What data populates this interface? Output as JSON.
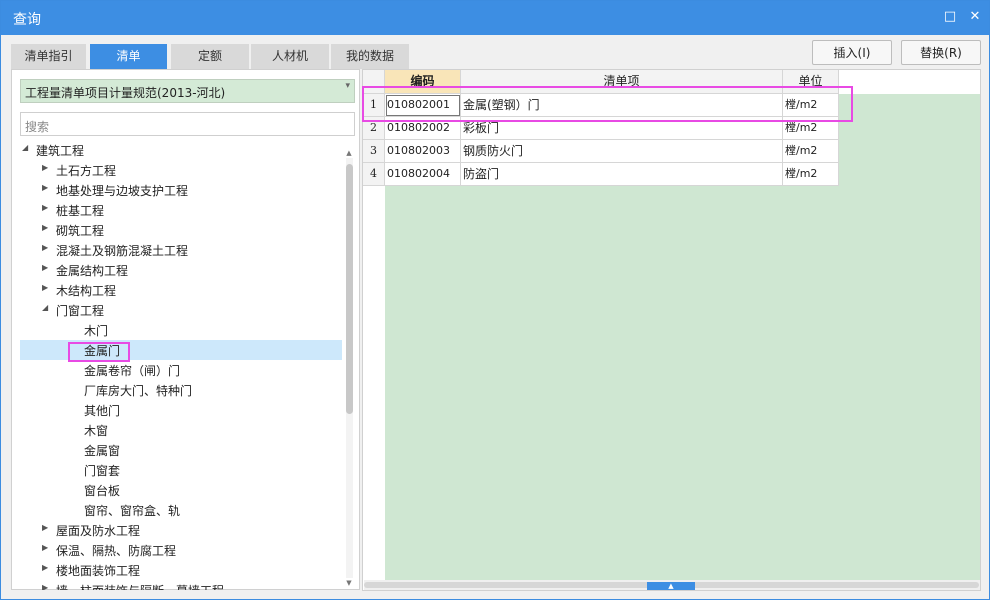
{
  "window": {
    "title": "查询",
    "restore_glyph": "□",
    "close_glyph": "✕"
  },
  "tabs": [
    {
      "label": "清单指引",
      "active": false
    },
    {
      "label": "清单",
      "active": true
    },
    {
      "label": "定额",
      "active": false
    },
    {
      "label": "人材机",
      "active": false
    },
    {
      "label": "我的数据",
      "active": false
    }
  ],
  "actions": {
    "insert_label": "插入(I)",
    "replace_label": "替换(R)"
  },
  "left_panel": {
    "spec_select": {
      "value": "工程量清单项目计量规范(2013-河北)",
      "arrow": "▾"
    },
    "search": {
      "placeholder": "搜索",
      "value": ""
    },
    "tree": [
      {
        "label": "建筑工程",
        "level": 0,
        "state": "expanded"
      },
      {
        "label": "土石方工程",
        "level": 1,
        "state": "collapsed"
      },
      {
        "label": "地基处理与边坡支护工程",
        "level": 1,
        "state": "collapsed"
      },
      {
        "label": "桩基工程",
        "level": 1,
        "state": "collapsed"
      },
      {
        "label": "砌筑工程",
        "level": 1,
        "state": "collapsed"
      },
      {
        "label": "混凝土及钢筋混凝土工程",
        "level": 1,
        "state": "collapsed"
      },
      {
        "label": "金属结构工程",
        "level": 1,
        "state": "collapsed"
      },
      {
        "label": "木结构工程",
        "level": 1,
        "state": "collapsed"
      },
      {
        "label": "门窗工程",
        "level": 1,
        "state": "expanded"
      },
      {
        "label": "木门",
        "level": 2,
        "state": "leaf"
      },
      {
        "label": "金属门",
        "level": 2,
        "state": "leaf",
        "selected": true
      },
      {
        "label": "金属卷帘（闸）门",
        "level": 2,
        "state": "leaf"
      },
      {
        "label": "厂库房大门、特种门",
        "level": 2,
        "state": "leaf"
      },
      {
        "label": "其他门",
        "level": 2,
        "state": "leaf"
      },
      {
        "label": "木窗",
        "level": 2,
        "state": "leaf"
      },
      {
        "label": "金属窗",
        "level": 2,
        "state": "leaf"
      },
      {
        "label": "门窗套",
        "level": 2,
        "state": "leaf"
      },
      {
        "label": "窗台板",
        "level": 2,
        "state": "leaf"
      },
      {
        "label": "窗帘、窗帘盒、轨",
        "level": 2,
        "state": "leaf"
      },
      {
        "label": "屋面及防水工程",
        "level": 1,
        "state": "collapsed"
      },
      {
        "label": "保温、隔热、防腐工程",
        "level": 1,
        "state": "collapsed"
      },
      {
        "label": "楼地面装饰工程",
        "level": 1,
        "state": "collapsed"
      },
      {
        "label": "墙、柱面装饰与隔断、幕墙工程",
        "level": 1,
        "state": "collapsed"
      }
    ]
  },
  "grid": {
    "headers": {
      "code": "编码",
      "name": "清单项",
      "unit": "单位"
    },
    "rows": [
      {
        "num": "1",
        "code": "010802001",
        "name": "金属(塑钢）门",
        "unit": "樘/m2"
      },
      {
        "num": "2",
        "code": "010802002",
        "name": "彩板门",
        "unit": "樘/m2"
      },
      {
        "num": "3",
        "code": "010802003",
        "name": "钢质防火门",
        "unit": "樘/m2"
      },
      {
        "num": "4",
        "code": "010802004",
        "name": "防盗门",
        "unit": "樘/m2"
      }
    ],
    "splitter_glyph": "▲"
  },
  "colors": {
    "accent": "#3d8ee3",
    "highlight": "#e84ae4",
    "grid_bg": "#cfe7d2",
    "selected_row": "#cde8fb"
  }
}
